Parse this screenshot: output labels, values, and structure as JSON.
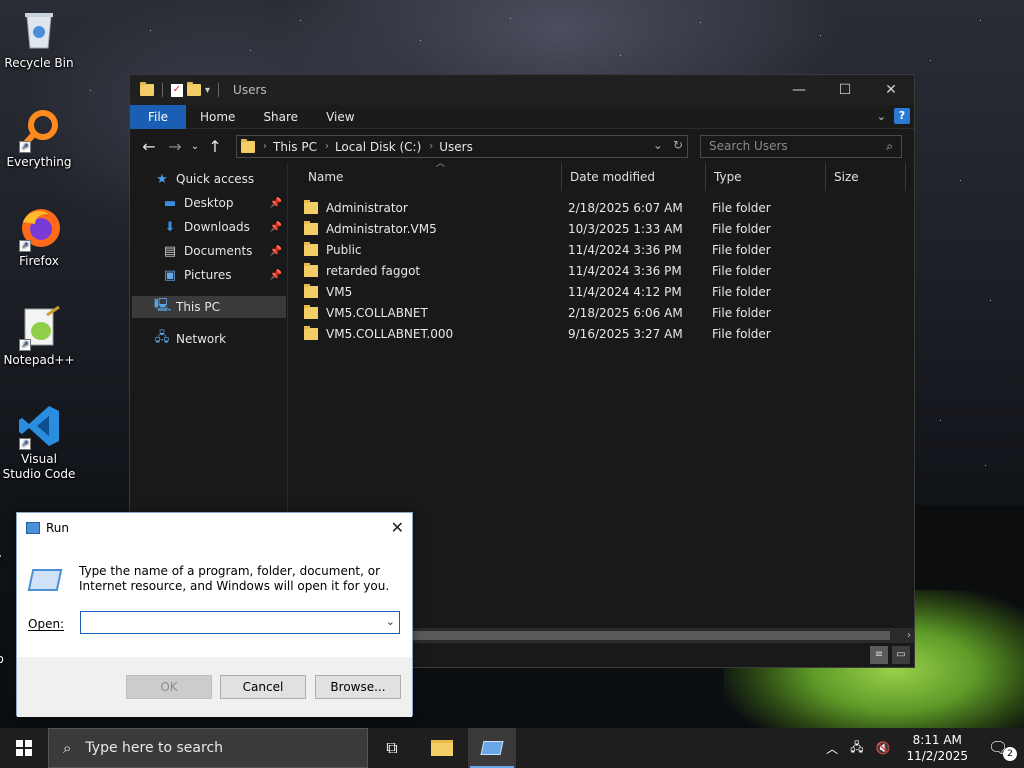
{
  "desktop": {
    "icons": [
      {
        "label": "Recycle Bin"
      },
      {
        "label": "Everything"
      },
      {
        "label": "Firefox"
      },
      {
        "label": "Notepad++"
      },
      {
        "label": "Visual Studio Code"
      }
    ],
    "partial_labels": [
      "V",
      "Lo"
    ]
  },
  "explorer": {
    "title": "Users",
    "ribbon_tabs": [
      "File",
      "Home",
      "Share",
      "View"
    ],
    "address": {
      "crumbs": [
        "This PC",
        "Local Disk (C:)",
        "Users"
      ]
    },
    "search_placeholder": "Search Users",
    "nav": {
      "quick_access": "Quick access",
      "items": [
        "Desktop",
        "Downloads",
        "Documents",
        "Pictures"
      ],
      "this_pc": "This PC",
      "network": "Network"
    },
    "columns": {
      "name": "Name",
      "date": "Date modified",
      "type": "Type",
      "size": "Size"
    },
    "rows": [
      {
        "name": "Administrator",
        "date": "2/18/2025 6:07 AM",
        "type": "File folder"
      },
      {
        "name": "Administrator.VM5",
        "date": "10/3/2025 1:33 AM",
        "type": "File folder"
      },
      {
        "name": "Public",
        "date": "11/4/2024 3:36 PM",
        "type": "File folder"
      },
      {
        "name": "retarded faggot",
        "date": "11/4/2024 3:36 PM",
        "type": "File folder"
      },
      {
        "name": "VM5",
        "date": "11/4/2024 4:12 PM",
        "type": "File folder"
      },
      {
        "name": "VM5.COLLABNET",
        "date": "2/18/2025 6:06 AM",
        "type": "File folder"
      },
      {
        "name": "VM5.COLLABNET.000",
        "date": "9/16/2025 3:27 AM",
        "type": "File folder"
      }
    ]
  },
  "run": {
    "title": "Run",
    "description": "Type the name of a program, folder, document, or Internet resource, and Windows will open it for you.",
    "open_label": "Open:",
    "input_value": "",
    "buttons": {
      "ok": "OK",
      "cancel": "Cancel",
      "browse": "Browse..."
    }
  },
  "taskbar": {
    "search_placeholder": "Type here to search",
    "time": "8:11 AM",
    "date": "11/2/2025",
    "notification_count": "2"
  },
  "colors": {
    "accent": "#1a5fb4",
    "folder": "#f3cd66",
    "window_bg": "#191919"
  }
}
